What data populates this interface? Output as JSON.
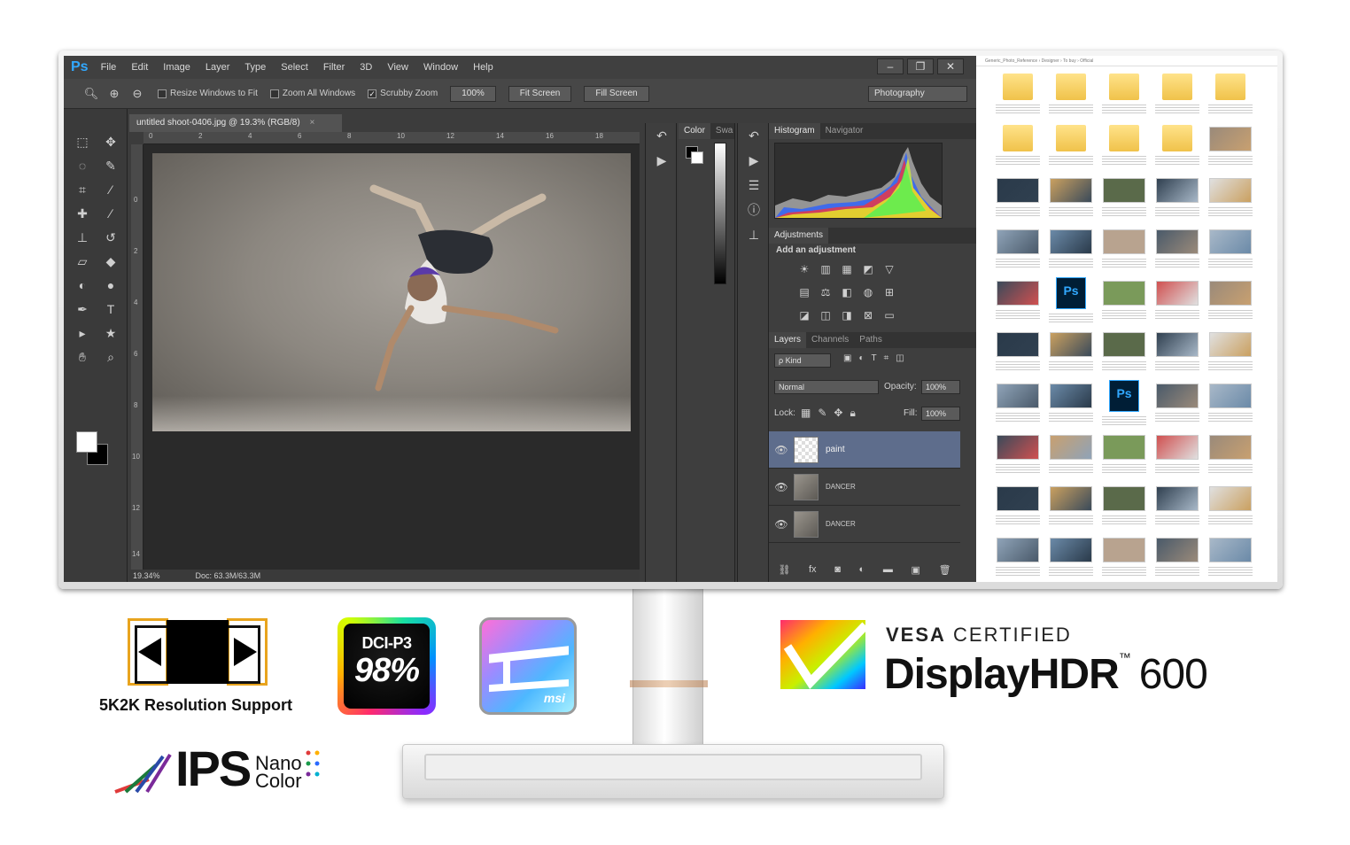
{
  "photoshop": {
    "logo": "Ps",
    "menu": [
      "File",
      "Edit",
      "Image",
      "Layer",
      "Type",
      "Select",
      "Filter",
      "3D",
      "View",
      "Window",
      "Help"
    ],
    "window_controls": [
      "–",
      "❐",
      "✕"
    ],
    "options": {
      "resize_windows": "Resize Windows to Fit",
      "zoom_all": "Zoom All Windows",
      "scrubby_zoom": "Scrubby Zoom",
      "zoom_value": "100%",
      "fit_screen": "Fit Screen",
      "fill_screen": "Fill Screen",
      "workspace": "Photography"
    },
    "document_tab": "untitled shoot-0406.jpg @ 19.3% (RGB/8)",
    "ruler_h": [
      "0",
      "2",
      "4",
      "6",
      "8",
      "10",
      "12",
      "14",
      "16",
      "18"
    ],
    "ruler_v": [
      "0",
      "2",
      "4",
      "6",
      "8",
      "10",
      "12",
      "14"
    ],
    "status": {
      "zoom": "19.34%",
      "doc": "Doc: 63.3M/63.3M"
    },
    "color_panel_tabs": [
      "Color",
      "Swa"
    ],
    "histogram_tabs": [
      "Histogram",
      "Navigator"
    ],
    "adjustments": {
      "tab": "Adjustments",
      "title": "Add an adjustment"
    },
    "layer_tabs": [
      "Layers",
      "Channels",
      "Paths"
    ],
    "layers_controls": {
      "kind": "ρ Kind",
      "blend": "Normal",
      "opacity_label": "Opacity:",
      "opacity": "100%",
      "lock_label": "Lock:",
      "fill_label": "Fill:",
      "fill": "100%"
    },
    "layers": [
      {
        "name": "paint",
        "active": true
      },
      {
        "name": "DANCER",
        "active": false
      },
      {
        "name": "DANCER",
        "active": false
      }
    ]
  },
  "explorer": {
    "address": "Generic_Photo_Reference › Designer › To buy › Official"
  },
  "badges": {
    "resolution_label": "5K2K Resolution Support",
    "dci_line1": "DCI-P3",
    "dci_line2": "98%",
    "msi_logo": "msi",
    "vesa_word": "VESA",
    "vesa_certified": "CERTIFIED",
    "vesa_product": "DisplayHDR",
    "vesa_tm": "™",
    "vesa_level": "600",
    "ips_word": "IPS",
    "ips_nano": "Nano",
    "ips_color": "Color"
  },
  "colors": {
    "ps_blue": "#31a8ff",
    "layer_highlight": "#5e6d8c",
    "badge_orange": "#e8a41e",
    "folder_yellow": "#f0c24a"
  }
}
